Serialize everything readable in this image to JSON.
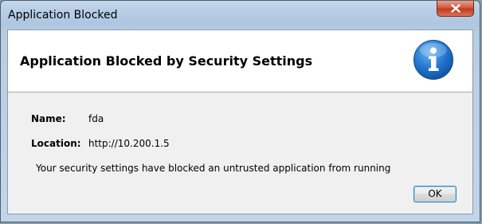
{
  "window": {
    "title": "Application Blocked",
    "close_icon": "close-icon"
  },
  "header": {
    "title": "Application Blocked by Security Settings",
    "icon": "info-icon",
    "icon_color": "#1f6fc6"
  },
  "fields": {
    "name_label": "Name:",
    "name_value": "fda",
    "location_label": "Location:",
    "location_value": "http://10.200.1.5"
  },
  "message": "Your security settings have blocked an untrusted application from running",
  "buttons": {
    "ok_label": "OK"
  },
  "colors": {
    "close_button": "#c7432a",
    "ok_focus_border": "#3c7fb1"
  }
}
